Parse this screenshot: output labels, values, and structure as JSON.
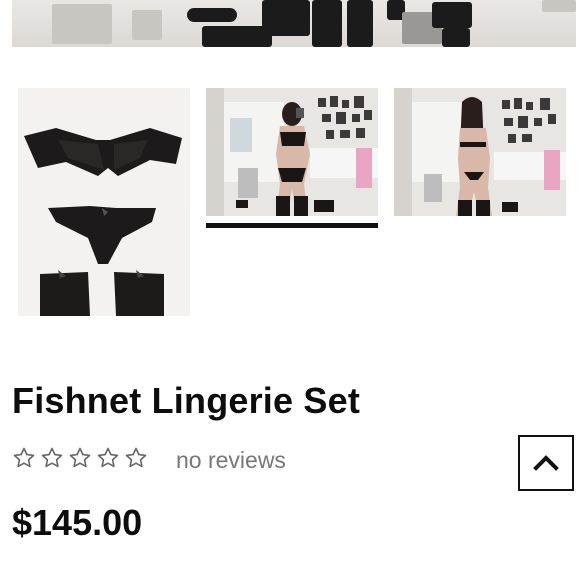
{
  "product": {
    "title": "Fishnet Lingerie Set",
    "rating_stars": 0,
    "rating_max": 5,
    "reviews_text": "no reviews",
    "price": "$145.00"
  },
  "gallery": {
    "thumbnails": [
      {
        "name": "lingerie-flatlay"
      },
      {
        "name": "model-front-mirror"
      },
      {
        "name": "model-back-mirror"
      }
    ],
    "active_index": 1
  },
  "icons": {
    "star": "star-outline-icon",
    "back_to_top": "chevron-up-icon"
  },
  "colors": {
    "text": "#0d0d0d",
    "muted": "#777777",
    "star_outline": "#666666"
  }
}
